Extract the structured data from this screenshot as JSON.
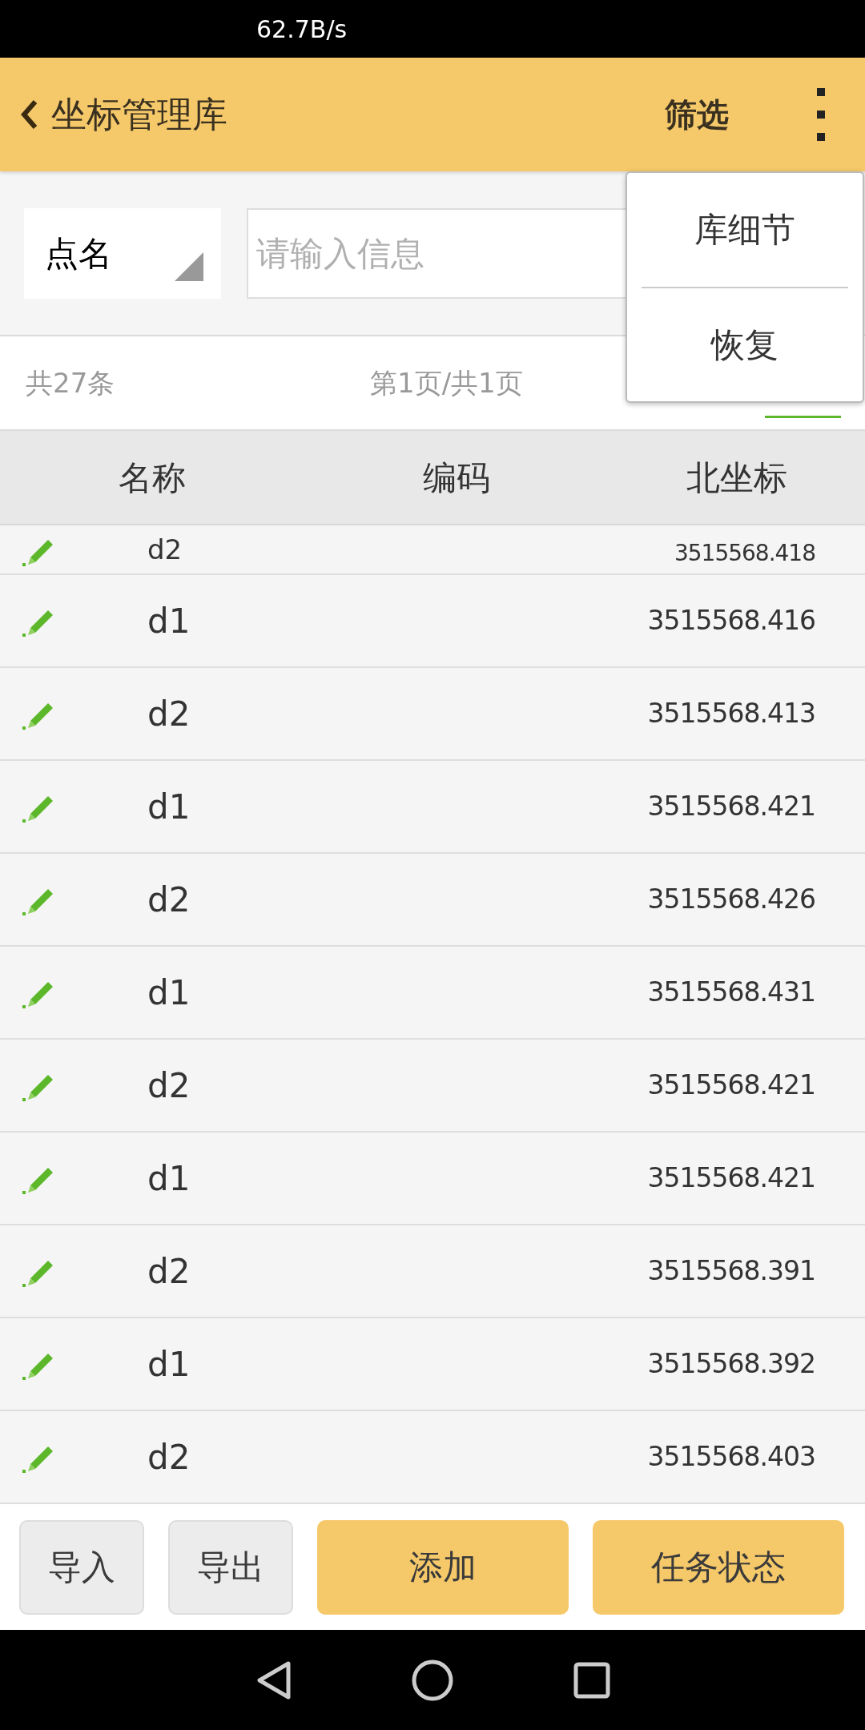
{
  "status_bar": {
    "speed": "62.7B/s"
  },
  "header": {
    "title": "坐标管理库",
    "filter": "筛选"
  },
  "menu": {
    "items": [
      "库细节",
      "恢复"
    ]
  },
  "search": {
    "field_select": "点名",
    "placeholder": "请输入信息"
  },
  "summary": {
    "total": "共27条",
    "page": "第1页/共1页"
  },
  "table": {
    "columns": [
      "名称",
      "编码",
      "北坐标"
    ],
    "rows": [
      {
        "name": "d2",
        "north": "3515568.418",
        "partial": true
      },
      {
        "name": "d1",
        "north": "3515568.416",
        "partial": false
      },
      {
        "name": "d2",
        "north": "3515568.413",
        "partial": false
      },
      {
        "name": "d1",
        "north": "3515568.421",
        "partial": false
      },
      {
        "name": "d2",
        "north": "3515568.426",
        "partial": false
      },
      {
        "name": "d1",
        "north": "3515568.431",
        "partial": false
      },
      {
        "name": "d2",
        "north": "3515568.421",
        "partial": false
      },
      {
        "name": "d1",
        "north": "3515568.421",
        "partial": false
      },
      {
        "name": "d2",
        "north": "3515568.391",
        "partial": false
      },
      {
        "name": "d1",
        "north": "3515568.392",
        "partial": false
      },
      {
        "name": "d2",
        "north": "3515568.403",
        "partial": false
      }
    ]
  },
  "buttons": [
    {
      "label": "导入",
      "kind": "plain"
    },
    {
      "label": "导出",
      "kind": "plain"
    },
    {
      "label": "添加",
      "kind": "primary"
    },
    {
      "label": "任务状态",
      "kind": "primary"
    }
  ]
}
